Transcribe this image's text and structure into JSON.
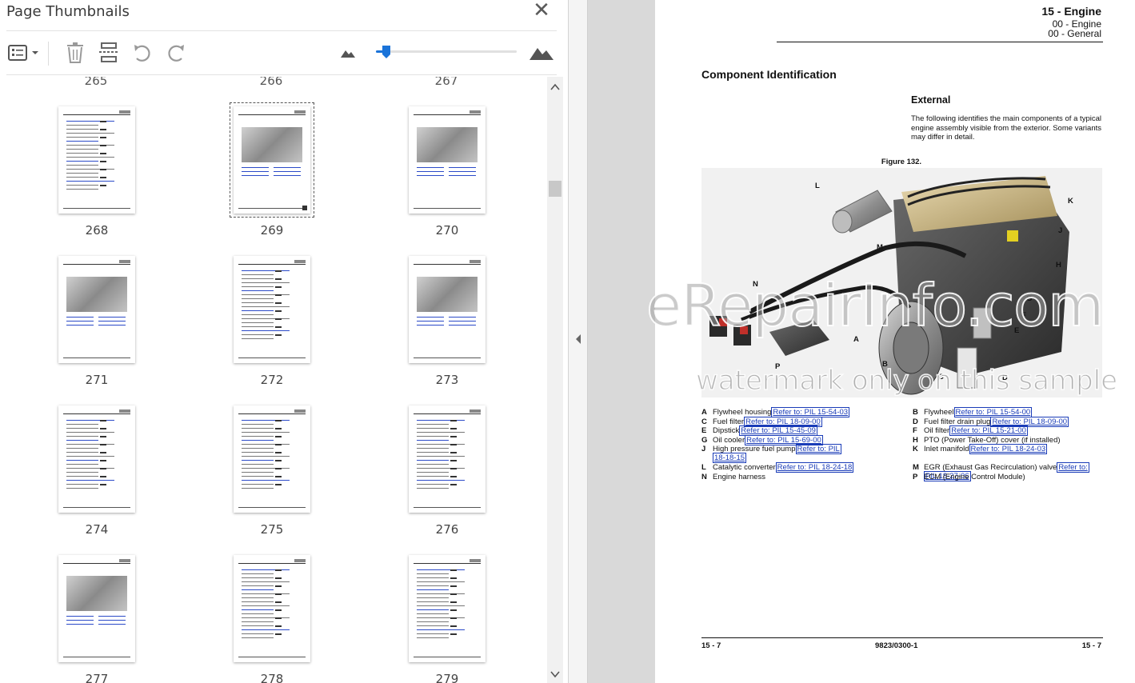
{
  "panel": {
    "title": "Page Thumbnails",
    "close_label": "✕",
    "partial_numbers": [
      "265",
      "266",
      "267"
    ],
    "zoom_fraction": 0.04
  },
  "thumbnails": [
    {
      "number": "268"
    },
    {
      "number": "269"
    },
    {
      "number": "270"
    },
    {
      "number": "271"
    },
    {
      "number": "272"
    },
    {
      "number": "273"
    },
    {
      "number": "274"
    },
    {
      "number": "275"
    },
    {
      "number": "276"
    },
    {
      "number": "277"
    },
    {
      "number": "278"
    },
    {
      "number": "279"
    }
  ],
  "selected_thumbnail": "269",
  "document": {
    "section_title": "15 - Engine",
    "section_sub1": "00 - Engine",
    "section_sub2": "00 - General",
    "heading": "Component Identification",
    "subheading": "External",
    "intro": "The following identifies the main components of a typical engine assembly visible from the exterior. Some variants may differ in detail.",
    "figure_caption": "Figure 132.",
    "callouts": [
      "L",
      "K",
      "J",
      "M",
      "H",
      "N",
      "G",
      "F",
      "E",
      "A",
      "B",
      "P",
      "C",
      "D"
    ],
    "watermark_main": "eRepairInfo.com",
    "watermark_sub": "watermark only on this sample",
    "legend": [
      {
        "key": "A",
        "text": "Flywheel housing",
        "ref": "Refer to: PIL 15-54-03"
      },
      {
        "key": "B",
        "text": "Flywheel",
        "ref": "Refer to: PIL 15-54-00"
      },
      {
        "key": "C",
        "text": "Fuel filter",
        "ref": "Refer to: PIL 18-09-00"
      },
      {
        "key": "D",
        "text": "Fuel filter drain plug",
        "ref": "Refer to: PIL 18-09-00"
      },
      {
        "key": "E",
        "text": "Dipstick",
        "ref": "Refer to: PIL 15-45-09"
      },
      {
        "key": "F",
        "text": "Oil filter",
        "ref": "Refer to: PIL 15-21-00"
      },
      {
        "key": "G",
        "text": "Oil cooler",
        "ref": "Refer to: PIL 15-69-00"
      },
      {
        "key": "H",
        "text": "PTO (Power Take-Off) cover (if installed)",
        "ref": ""
      },
      {
        "key": "J",
        "text": "High pressure fuel pump",
        "ref": "Refer to: PIL",
        "ref2": "18-18-15"
      },
      {
        "key": "K",
        "text": "Inlet manifold",
        "ref": "Refer to: PIL 18-24-03"
      },
      {
        "key": "L",
        "text": "Catalytic converter",
        "ref": "Refer to: PIL 18-24-18"
      },
      {
        "key": "M",
        "text": "EGR (Exhaust Gas Recirculation) valve",
        "ref": "Refer to:",
        "ref2": "PIL 18-27-06"
      },
      {
        "key": "N",
        "text": "Engine harness",
        "ref": ""
      },
      {
        "key": "P",
        "text": "ECM (Engine Control Module)",
        "ref": ""
      }
    ],
    "footer_left": "15 - 7",
    "footer_mid": "9823/0300-1",
    "footer_right": "15 - 7"
  }
}
